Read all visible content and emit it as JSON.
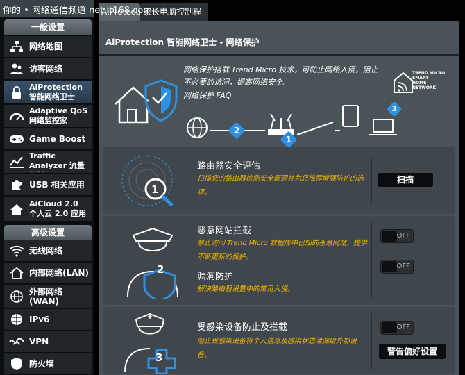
{
  "watermark": "你的 • 网络通信频道 net.it168.com",
  "tabs": [
    "AiProtection",
    "家长电脑控制程序"
  ],
  "sidebar": {
    "general_header": "一般设置",
    "advanced_header": "高级设置",
    "general_items": [
      {
        "label": "网络地图",
        "icon": "network-map-icon"
      },
      {
        "label": "访客网络",
        "icon": "guest-network-icon"
      },
      {
        "label": "AiProtection\n智能网络卫士",
        "icon": "aiprotection-lock-icon"
      },
      {
        "label": "Adaptive QoS\n网络监控家",
        "icon": "qos-gauge-icon"
      },
      {
        "label": "Game Boost",
        "icon": "gamepad-icon"
      },
      {
        "label": "Traffic\nAnalyzer 流量分析",
        "icon": "traffic-chart-icon"
      },
      {
        "label": "USB 相关应用",
        "icon": "puzzle-icon"
      },
      {
        "label": "AiCloud 2.0\n个人云 2.0 应用",
        "icon": "cloud-home-icon"
      }
    ],
    "advanced_items": [
      {
        "label": "无线网络",
        "icon": "wifi-icon"
      },
      {
        "label": "内部网络(LAN)",
        "icon": "lan-home-icon"
      },
      {
        "label": "外部网络\n(WAN)",
        "icon": "globe-icon"
      },
      {
        "label": "IPv6",
        "icon": "ipv6-globe-icon"
      },
      {
        "label": "VPN",
        "icon": "vpn-icon"
      },
      {
        "label": "防火墙",
        "icon": "firewall-shield-icon"
      }
    ]
  },
  "main": {
    "title": "AiProtection 智能网络卫士 - 网络保护",
    "description": "网络保护搭载 Trend Micro 技术，可防止网络入侵，阻止不必要的访问，提高网络安全。",
    "faq_link": "网络保护 FAQ",
    "trend_logo": "TREND MICRO\nSMART\nHOME\nNETWORK",
    "diagram_steps": [
      "2",
      "1",
      "3"
    ]
  },
  "cards": {
    "assessment": {
      "title": "路由器安全评估",
      "desc": "扫描您的路由器检测安全漏洞并为您推荐增强防护的选项。",
      "button": "扫描",
      "badge": "1"
    },
    "malicious": {
      "title": "恶意网站拦截",
      "desc": "禁止访问 Trend Micro 数据库中已知的恶意网站，提供不断更新的保护。",
      "toggle": "OFF",
      "badge": "2"
    },
    "vulnerability": {
      "title": "漏洞防护",
      "desc": "解决路由器设置中的常见入侵。",
      "toggle": "OFF"
    },
    "infected": {
      "title": "受感染设备防止及拦截",
      "desc": "阻止受感染设备将个人信息及感染状态泄漏给外部设备。",
      "toggle": "OFF",
      "button": "警告偏好设置",
      "badge": "3"
    }
  },
  "colors": {
    "accent_blue": "#2f8fe0",
    "warning_yellow": "#f3b400",
    "panel": "#4a5358"
  }
}
